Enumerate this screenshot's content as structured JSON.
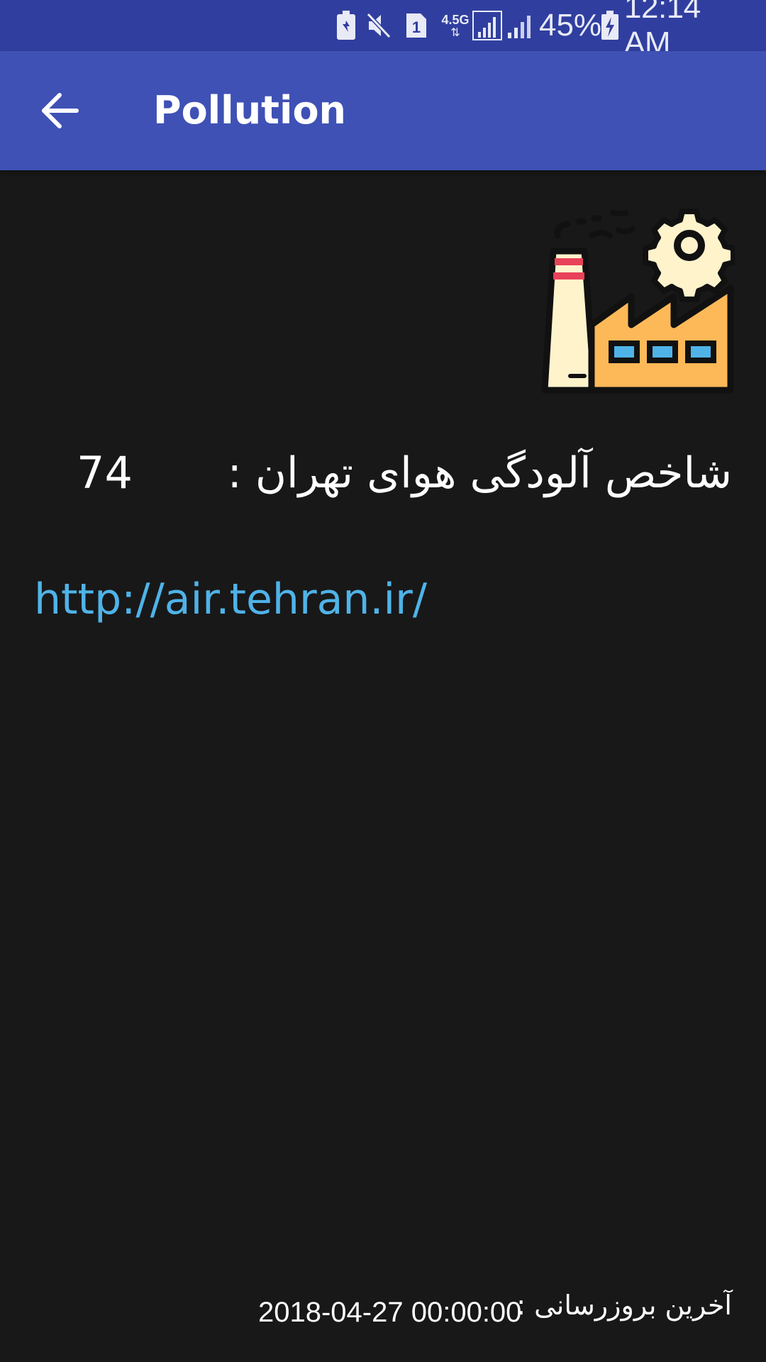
{
  "status_bar": {
    "network_type": "4.5G",
    "sim_slot": "1",
    "battery_percent": "45%",
    "time": "12:14 AM",
    "icons": [
      "battery-saver-icon",
      "mute-icon",
      "sim-icon",
      "network-4-5g-icon",
      "signal-strength-icon",
      "signal-strength-2-icon",
      "battery-charging-icon"
    ]
  },
  "app_bar": {
    "title": "Pollution",
    "back_icon": "arrow-back-icon",
    "color": "#3f51b5",
    "status_color": "#303f9f"
  },
  "content": {
    "illustration_icon": "factory-icon",
    "index_label": "شاخص آلودگی هوای تهران :",
    "index_value": "74",
    "source_link": "http://air.tehran.ir/",
    "last_update_label": "آخرین بروزرسانی :",
    "last_update_value": "2018-04-27 00:00:00",
    "link_color": "#4fb3e8",
    "background": "#181818"
  }
}
